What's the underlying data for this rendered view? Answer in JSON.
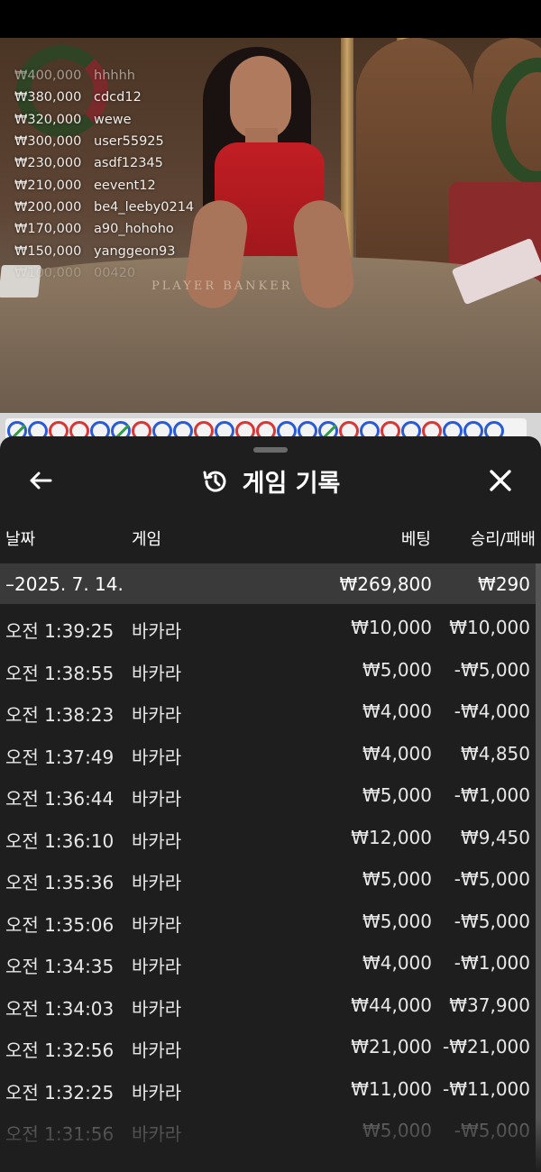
{
  "leaderboard": [
    {
      "amount": "₩400,000",
      "user": "hhhhh"
    },
    {
      "amount": "₩380,000",
      "user": "cdcd12"
    },
    {
      "amount": "₩320,000",
      "user": "wewe"
    },
    {
      "amount": "₩300,000",
      "user": "user55925"
    },
    {
      "amount": "₩230,000",
      "user": "asdf12345"
    },
    {
      "amount": "₩210,000",
      "user": "eevent12"
    },
    {
      "amount": "₩200,000",
      "user": "be4_leeby0214"
    },
    {
      "amount": "₩170,000",
      "user": "a90_hohoho"
    },
    {
      "amount": "₩150,000",
      "user": "yanggeon93"
    },
    {
      "amount": "₩100,000",
      "user": "00420"
    }
  ],
  "table_text": "PLAYER   BANKER",
  "road_beads": [
    "tie",
    "blue",
    "banker",
    "banker",
    "blue",
    "tie",
    "banker",
    "blue",
    "blue",
    "banker",
    "blue",
    "banker",
    "banker",
    "blue",
    "blue",
    "tie",
    "banker",
    "blue",
    "banker",
    "blue",
    "banker",
    "blue",
    "blue",
    "blue"
  ],
  "sheet": {
    "title": "게임 기록",
    "icons": {
      "back": "arrow-left-icon",
      "title": "history-icon",
      "close": "close-icon"
    },
    "columns": {
      "date": "날짜",
      "game": "게임",
      "bet": "베팅",
      "result": "승리/패배"
    },
    "date_group": {
      "label": "–2025. 7. 14.",
      "bet_total": "₩269,800",
      "result_total": "₩290"
    },
    "rows": [
      {
        "time": "오전 1:39:25",
        "game": "바카라",
        "bet": "₩10,000",
        "result": "₩10,000"
      },
      {
        "time": "오전 1:38:55",
        "game": "바카라",
        "bet": "₩5,000",
        "result": "-₩5,000"
      },
      {
        "time": "오전 1:38:23",
        "game": "바카라",
        "bet": "₩4,000",
        "result": "-₩4,000"
      },
      {
        "time": "오전 1:37:49",
        "game": "바카라",
        "bet": "₩4,000",
        "result": "₩4,850"
      },
      {
        "time": "오전 1:36:44",
        "game": "바카라",
        "bet": "₩5,000",
        "result": "-₩1,000"
      },
      {
        "time": "오전 1:36:10",
        "game": "바카라",
        "bet": "₩12,000",
        "result": "₩9,450"
      },
      {
        "time": "오전 1:35:36",
        "game": "바카라",
        "bet": "₩5,000",
        "result": "-₩5,000"
      },
      {
        "time": "오전 1:35:06",
        "game": "바카라",
        "bet": "₩5,000",
        "result": "-₩5,000"
      },
      {
        "time": "오전 1:34:35",
        "game": "바카라",
        "bet": "₩4,000",
        "result": "-₩1,000"
      },
      {
        "time": "오전 1:34:03",
        "game": "바카라",
        "bet": "₩44,000",
        "result": "₩37,900"
      },
      {
        "time": "오전 1:32:56",
        "game": "바카라",
        "bet": "₩21,000",
        "result": "-₩21,000"
      },
      {
        "time": "오전 1:32:25",
        "game": "바카라",
        "bet": "₩11,000",
        "result": "-₩11,000"
      },
      {
        "time": "오전 1:31:56",
        "game": "바카라",
        "bet": "₩5,000",
        "result": "-₩5,000"
      }
    ]
  }
}
